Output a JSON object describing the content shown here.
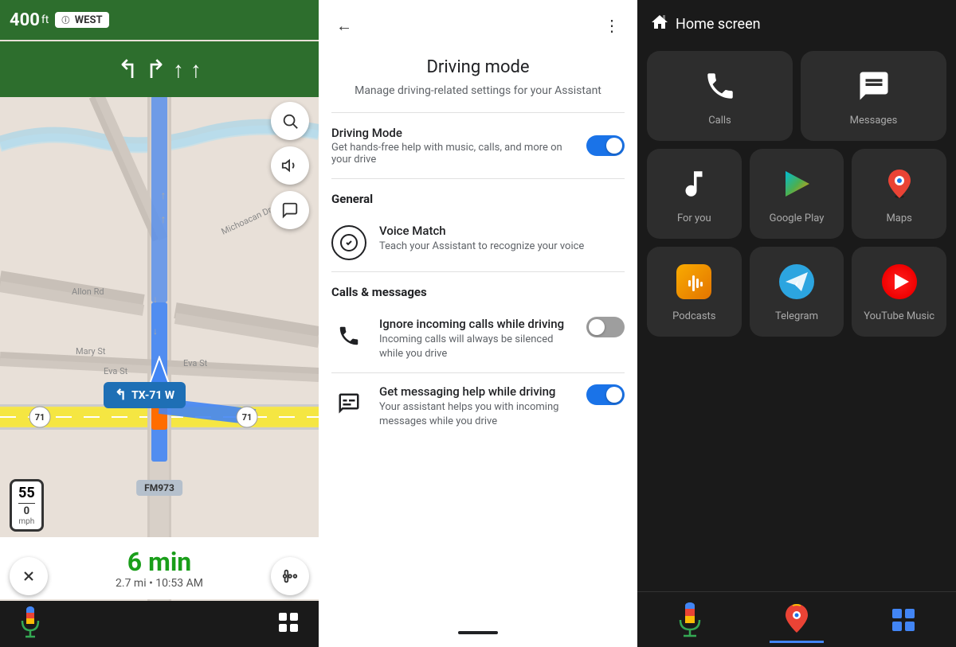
{
  "map": {
    "distance_to_turn": "400",
    "distance_unit": "ft",
    "highway_west": "WEST",
    "eta": "6 min",
    "distance_route": "2.7 mi",
    "arrival_time": "10:53 AM",
    "speed_limit": "55",
    "speed_current": "0",
    "speed_unit": "mph",
    "road_name": "FM973",
    "tx71_label": "TX-71 W",
    "turn_icon": "↰"
  },
  "settings": {
    "back_label": "←",
    "more_label": "⋮",
    "title": "Driving mode",
    "subtitle": "Manage driving-related settings for your Assistant",
    "driving_mode_label": "Driving Mode",
    "driving_mode_desc": "Get hands-free help with music, calls, and more on your drive",
    "driving_mode_on": true,
    "general_section": "General",
    "voice_match_title": "Voice Match",
    "voice_match_desc": "Teach your Assistant to recognize your voice",
    "calls_section": "Calls & messages",
    "ignore_calls_title": "Ignore incoming calls while driving",
    "ignore_calls_desc": "Incoming calls will always be silenced while you drive",
    "ignore_calls_on": false,
    "messaging_title": "Get messaging help while driving",
    "messaging_desc": "Your assistant helps you with incoming messages while you drive",
    "messaging_on": true
  },
  "home": {
    "header_title": "Home screen",
    "apps": {
      "row1": [
        {
          "label": "Calls",
          "icon_type": "phone"
        },
        {
          "label": "Messages",
          "icon_type": "messages"
        }
      ],
      "row2": [
        {
          "label": "For you",
          "icon_type": "music_note"
        },
        {
          "label": "Google Play",
          "icon_type": "google_play"
        },
        {
          "label": "Maps",
          "icon_type": "maps"
        }
      ],
      "row3": [
        {
          "label": "Podcasts",
          "icon_type": "podcasts"
        },
        {
          "label": "Telegram",
          "icon_type": "telegram"
        },
        {
          "label": "YouTube Music",
          "icon_type": "youtube_music"
        }
      ]
    },
    "bottom_mic_label": "mic",
    "bottom_maps_label": "maps",
    "bottom_grid_label": "grid"
  }
}
